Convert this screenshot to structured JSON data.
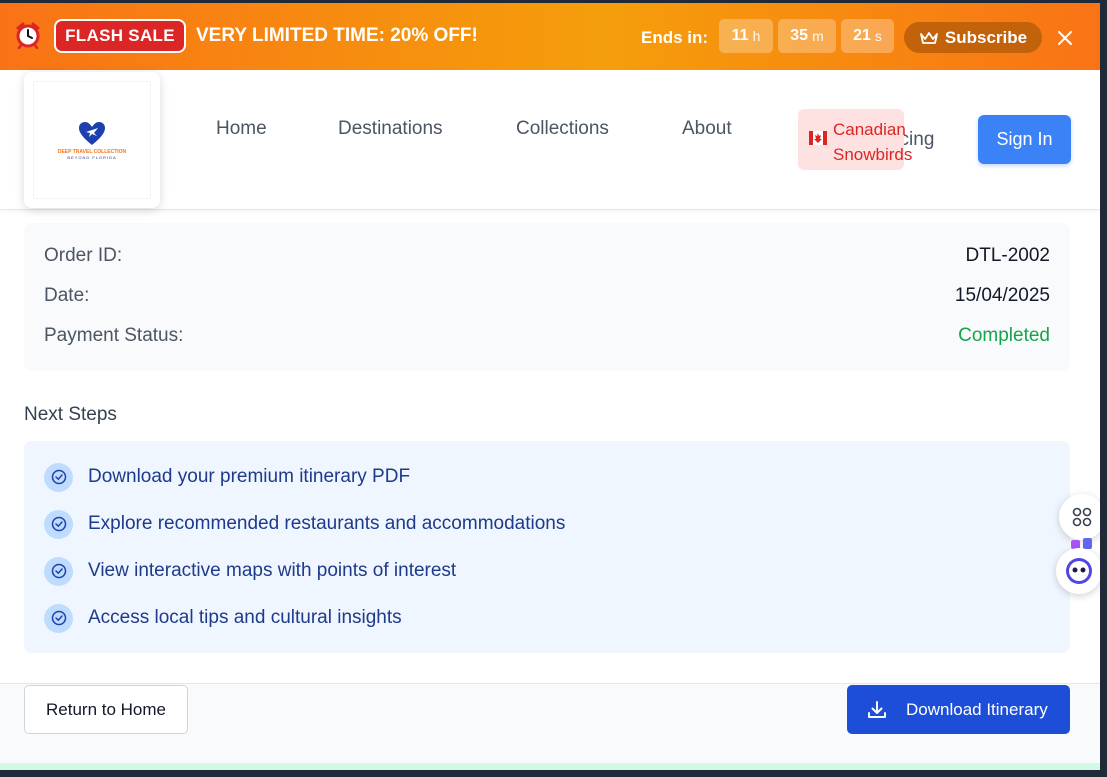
{
  "banner": {
    "badge": "FLASH SALE",
    "promo": "VERY LIMITED TIME:  20% OFF!",
    "ends_label": "Ends in:",
    "timer": [
      {
        "value": "11",
        "unit": "h"
      },
      {
        "value": "35",
        "unit": "m"
      },
      {
        "value": "21",
        "unit": "s"
      }
    ],
    "subscribe_label": "Subscribe",
    "icons": {
      "alarm": "alarm-clock-icon",
      "crown": "crown-icon",
      "close": "close-icon"
    }
  },
  "header": {
    "logo": {
      "name": "DEEP TRAVEL COLLECTION",
      "sub": "BEYOND FLORIDA"
    },
    "nav": [
      "Home",
      "Destinations",
      "Collections",
      "About"
    ],
    "canadian_line1": "Canadian",
    "canadian_line2": "Snowbirds",
    "pricing": "ricing",
    "signin": "Sign In"
  },
  "order": {
    "rows": [
      {
        "label": "Order ID:",
        "value": "DTL-2002"
      },
      {
        "label": "Date:",
        "value": "15/04/2025"
      },
      {
        "label": "Payment Status:",
        "value": "Completed"
      }
    ]
  },
  "next_steps": {
    "title": "Next Steps",
    "items": [
      "Download your premium itinerary PDF",
      "Explore recommended restaurants and accommodations",
      "View interactive maps with points of interest",
      "Access local tips and cultural insights"
    ]
  },
  "actions": {
    "return_label": "Return to Home",
    "download_label": "Download Itinerary"
  },
  "colors": {
    "accent": "#3b82f6",
    "banner": "#f97316",
    "flash": "#dc2626",
    "success": "#16a34a"
  }
}
